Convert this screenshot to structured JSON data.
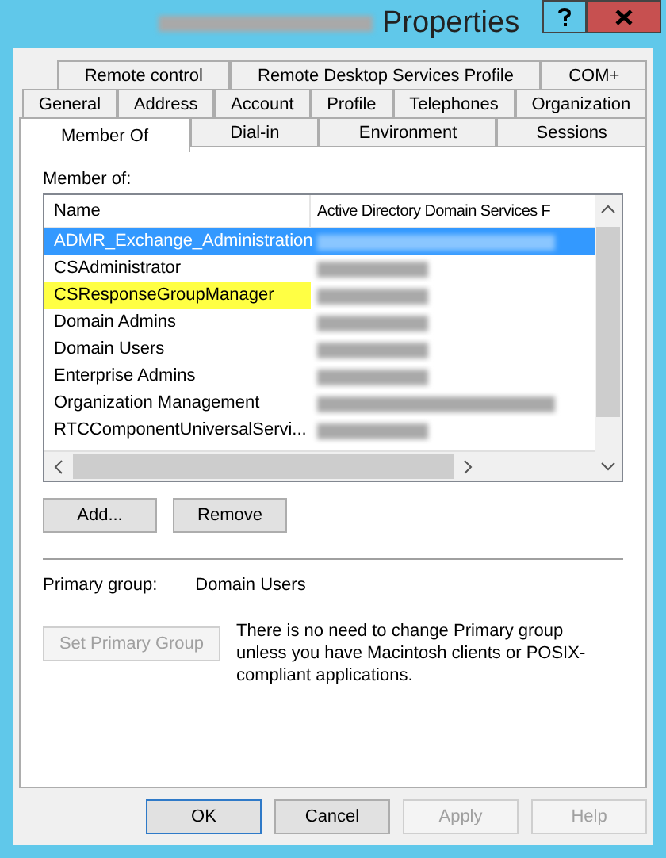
{
  "window": {
    "title": "Properties"
  },
  "tab_rows": [
    [
      {
        "label": "Remote control",
        "selected": false
      },
      {
        "label": "Remote Desktop Services Profile",
        "selected": false
      },
      {
        "label": "COM+",
        "selected": false
      }
    ],
    [
      {
        "label": "General",
        "selected": false
      },
      {
        "label": "Address",
        "selected": false
      },
      {
        "label": "Account",
        "selected": false
      },
      {
        "label": "Profile",
        "selected": false
      },
      {
        "label": "Telephones",
        "selected": false
      },
      {
        "label": "Organization",
        "selected": false
      }
    ],
    [
      {
        "label": "Member Of",
        "selected": true
      },
      {
        "label": "Dial-in",
        "selected": false
      },
      {
        "label": "Environment",
        "selected": false
      },
      {
        "label": "Sessions",
        "selected": false
      }
    ]
  ],
  "member_of": {
    "label": "Member of:",
    "columns": [
      "Name",
      "Active Directory Domain Services F"
    ],
    "rows": [
      {
        "name": "ADMR_Exchange_Administration",
        "selected": true,
        "highlighted": false
      },
      {
        "name": "CSAdministrator",
        "selected": false,
        "highlighted": false
      },
      {
        "name": "CSResponseGroupManager",
        "selected": false,
        "highlighted": true
      },
      {
        "name": "Domain Admins",
        "selected": false,
        "highlighted": false
      },
      {
        "name": "Domain Users",
        "selected": false,
        "highlighted": false
      },
      {
        "name": "Enterprise Admins",
        "selected": false,
        "highlighted": false
      },
      {
        "name": "Organization Management",
        "selected": false,
        "highlighted": false
      },
      {
        "name": "RTCComponentUniversalServi...",
        "selected": false,
        "highlighted": false
      }
    ]
  },
  "list_buttons": [
    {
      "label": "Add...",
      "disabled": false
    },
    {
      "label": "Remove",
      "disabled": false
    }
  ],
  "primary_group": {
    "label": "Primary group:",
    "value": "Domain Users"
  },
  "set_primary": {
    "label": "Set Primary Group",
    "disabled": true
  },
  "note": "There is no need to change Primary group unless you have Macintosh clients or POSIX-compliant applications.",
  "buttons": [
    {
      "label": "OK",
      "disabled": false,
      "default": true
    },
    {
      "label": "Cancel",
      "disabled": false,
      "default": false
    },
    {
      "label": "Apply",
      "disabled": true,
      "default": false
    },
    {
      "label": "Help",
      "disabled": true,
      "default": false
    }
  ]
}
